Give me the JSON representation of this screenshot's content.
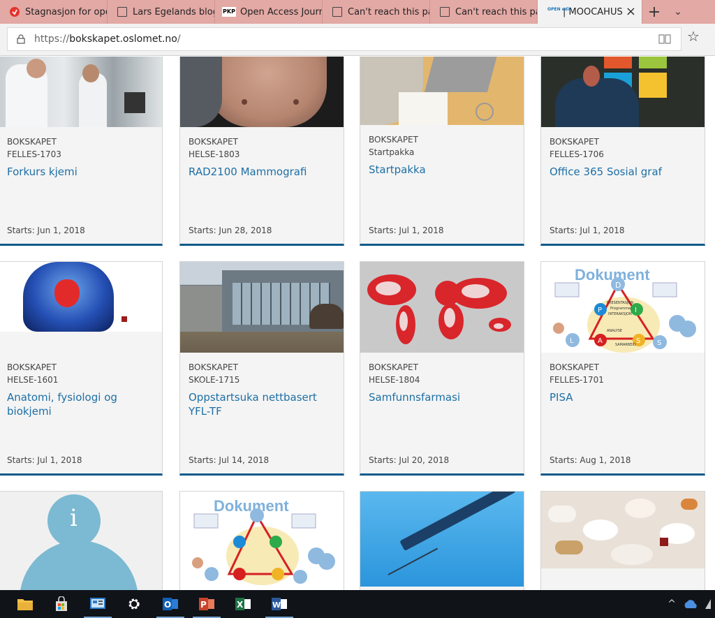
{
  "tabs": [
    {
      "label": "Stagnasjon for ope",
      "icon": "circle-logo-icon"
    },
    {
      "label": "Lars Egelands blog",
      "icon": "page-icon"
    },
    {
      "label": "Open Access Journ",
      "icon": "pkp-icon"
    },
    {
      "label": "Can't reach this pa",
      "icon": "page-icon"
    },
    {
      "label": "Can't reach this pa",
      "icon": "page-icon"
    },
    {
      "label": "| MOOCAHUS",
      "icon": "open-edx-icon",
      "active": true
    }
  ],
  "tab_icon_text": {
    "pkp": "PKP",
    "openedx": "OPEN edX"
  },
  "new_tab": "+",
  "tab_list": "⌄",
  "address": {
    "prefix": "https://",
    "host": "bokskapet.oslomet.no",
    "path": "/"
  },
  "courses": [
    {
      "org": "BOKSKAPET",
      "number": "FELLES-1703",
      "title": "Forkurs kjemi",
      "starts": "Starts: Jun 1, 2018",
      "image": "lab"
    },
    {
      "org": "BOKSKAPET",
      "number": "HELSE-1803",
      "title": "RAD2100 Mammografi",
      "starts": "Starts: Jun 28, 2018",
      "image": "skin"
    },
    {
      "org": "BOKSKAPET",
      "number": "Startpakka",
      "title": "Startpakka",
      "starts": "Starts: Jul 1, 2018",
      "image": "desk"
    },
    {
      "org": "BOKSKAPET",
      "number": "FELLES-1706",
      "title": "Office 365 Sosial graf",
      "starts": "Starts: Jul 1, 2018",
      "image": "office"
    },
    {
      "org": "BOKSKAPET",
      "number": "HELSE-1601",
      "title": "Anatomi, fysiologi og biokjemi",
      "starts": "Starts: Jul 1, 2018",
      "image": "anatomy"
    },
    {
      "org": "BOKSKAPET",
      "number": "SKOLE-1715",
      "title": "Oppstartsuka nettbasert YFL-TF",
      "starts": "Starts: Jul 14, 2018",
      "image": "building"
    },
    {
      "org": "BOKSKAPET",
      "number": "HELSE-1804",
      "title": "Samfunnsfarmasi",
      "starts": "Starts: Jul 20, 2018",
      "image": "worldmap"
    },
    {
      "org": "BOKSKAPET",
      "number": "FELLES-1701",
      "title": "PISA",
      "starts": "Starts: Aug 1, 2018",
      "image": "dokument"
    }
  ],
  "dokument_text": {
    "title": "Dokument",
    "letters": [
      "D",
      "P",
      "I",
      "L",
      "A",
      "S",
      "S"
    ],
    "labels": [
      "PRESENTASJON",
      "Programmer",
      "INTERAKSJON",
      "ANALYSE",
      "SAMARBEID"
    ]
  },
  "info_letter": "i",
  "taskbar_apps": [
    "file-explorer-icon",
    "store-icon",
    "control-panel-icon",
    "settings-icon",
    "outlook-icon",
    "powerpoint-icon",
    "excel-icon",
    "word-icon"
  ],
  "taskbar_letters": {
    "outlook": "O",
    "powerpoint": "P",
    "excel": "X",
    "word": "W"
  },
  "tray": {
    "chevron": "^"
  }
}
